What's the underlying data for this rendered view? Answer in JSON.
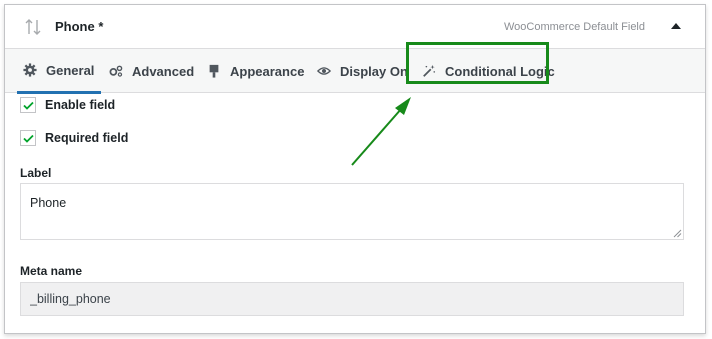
{
  "header": {
    "title": "Phone *",
    "field_type": "WooCommerce Default Field"
  },
  "tabs": [
    {
      "label": "General",
      "icon": "gear-icon",
      "active": true
    },
    {
      "label": "Advanced",
      "icon": "gears-icon",
      "active": false
    },
    {
      "label": "Appearance",
      "icon": "paint-brush-icon",
      "active": false
    },
    {
      "label": "Display On",
      "icon": "eye-icon",
      "active": false
    },
    {
      "label": "Conditional Logic",
      "icon": "magic-wand-icon",
      "active": false
    }
  ],
  "general": {
    "enable_field": {
      "label": "Enable field",
      "checked": true
    },
    "required_field": {
      "label": "Required field",
      "checked": true
    },
    "label_caption": "Label",
    "label_value": "Phone",
    "meta_caption": "Meta name",
    "meta_value": "_billing_phone"
  },
  "colors": {
    "accent": "#2271b1",
    "highlight": "#178a1a",
    "check": "#00a32a"
  }
}
